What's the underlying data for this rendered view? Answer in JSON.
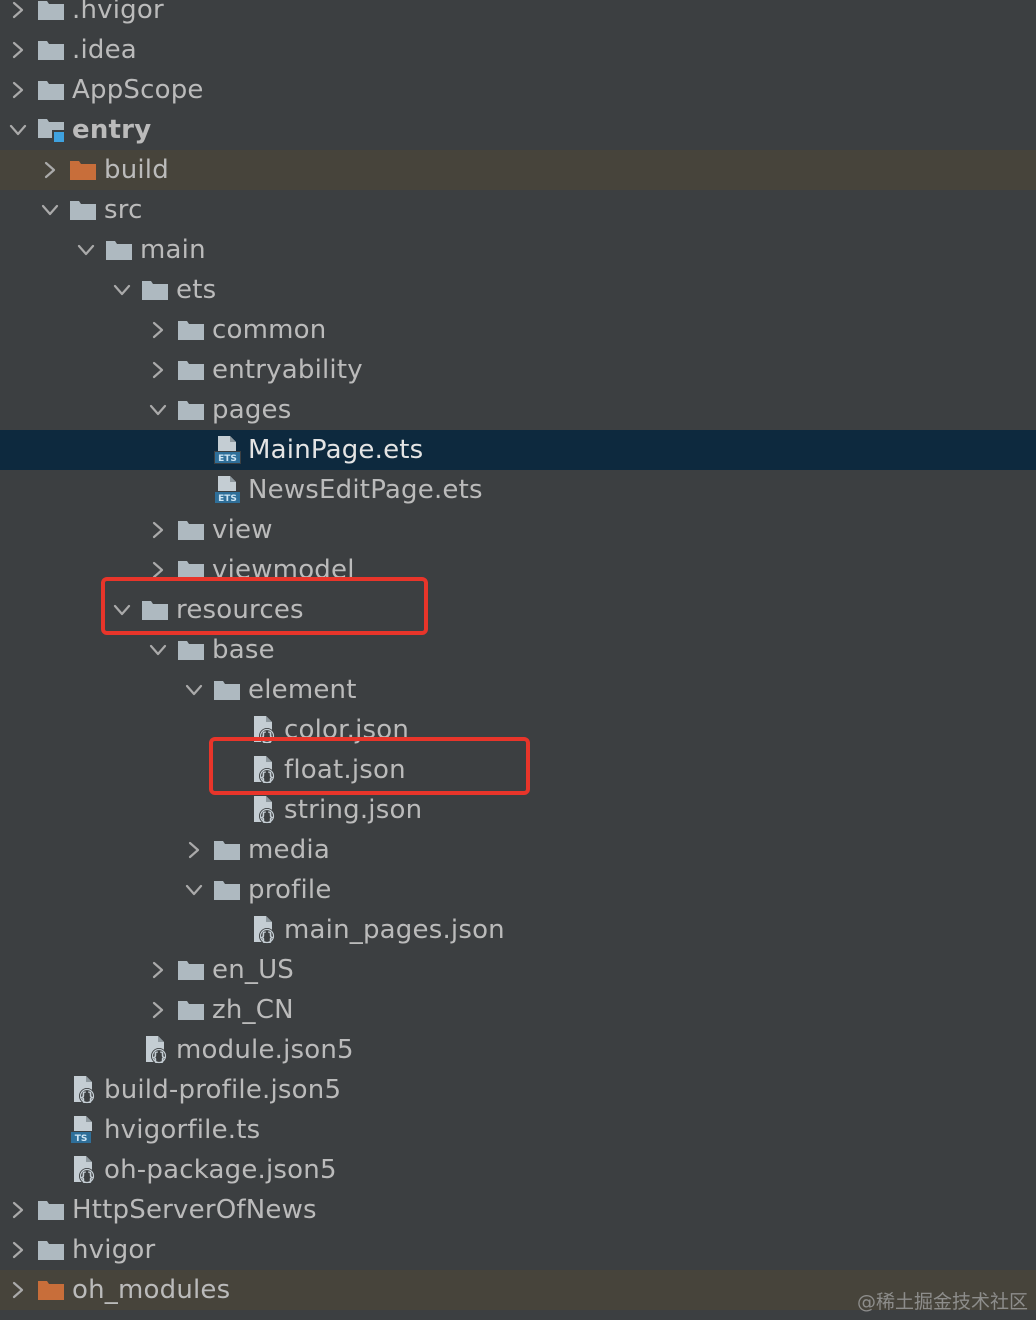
{
  "tree": [
    {
      "label": ".hvigor",
      "depth": 0,
      "type": "folder",
      "expanded": false
    },
    {
      "label": ".idea",
      "depth": 0,
      "type": "folder",
      "expanded": false
    },
    {
      "label": "AppScope",
      "depth": 0,
      "type": "folder",
      "expanded": false
    },
    {
      "label": "entry",
      "depth": 0,
      "type": "module",
      "expanded": true,
      "bold": true
    },
    {
      "label": "build",
      "depth": 1,
      "type": "folder-excluded",
      "expanded": false,
      "state": "excluded"
    },
    {
      "label": "src",
      "depth": 1,
      "type": "folder",
      "expanded": true
    },
    {
      "label": "main",
      "depth": 2,
      "type": "folder",
      "expanded": true
    },
    {
      "label": "ets",
      "depth": 3,
      "type": "folder",
      "expanded": true
    },
    {
      "label": "common",
      "depth": 4,
      "type": "folder",
      "expanded": false
    },
    {
      "label": "entryability",
      "depth": 4,
      "type": "folder",
      "expanded": false
    },
    {
      "label": "pages",
      "depth": 4,
      "type": "folder",
      "expanded": true
    },
    {
      "label": "MainPage.ets",
      "depth": 5,
      "type": "file-ets",
      "state": "selected"
    },
    {
      "label": "NewsEditPage.ets",
      "depth": 5,
      "type": "file-ets"
    },
    {
      "label": "view",
      "depth": 4,
      "type": "folder",
      "expanded": false
    },
    {
      "label": "viewmodel",
      "depth": 4,
      "type": "folder",
      "expanded": false
    },
    {
      "label": "resources",
      "depth": 3,
      "type": "folder",
      "expanded": true,
      "highlight": true
    },
    {
      "label": "base",
      "depth": 4,
      "type": "folder",
      "expanded": true
    },
    {
      "label": "element",
      "depth": 5,
      "type": "folder",
      "expanded": true
    },
    {
      "label": "color.json",
      "depth": 6,
      "type": "file-json"
    },
    {
      "label": "float.json",
      "depth": 6,
      "type": "file-json",
      "highlight": true
    },
    {
      "label": "string.json",
      "depth": 6,
      "type": "file-json"
    },
    {
      "label": "media",
      "depth": 5,
      "type": "folder",
      "expanded": false
    },
    {
      "label": "profile",
      "depth": 5,
      "type": "folder",
      "expanded": true
    },
    {
      "label": "main_pages.json",
      "depth": 6,
      "type": "file-json"
    },
    {
      "label": "en_US",
      "depth": 4,
      "type": "folder",
      "expanded": false
    },
    {
      "label": "zh_CN",
      "depth": 4,
      "type": "folder",
      "expanded": false
    },
    {
      "label": "module.json5",
      "depth": 3,
      "type": "file-json"
    },
    {
      "label": "build-profile.json5",
      "depth": 1,
      "type": "file-json"
    },
    {
      "label": "hvigorfile.ts",
      "depth": 1,
      "type": "file-ts"
    },
    {
      "label": "oh-package.json5",
      "depth": 1,
      "type": "file-json"
    },
    {
      "label": "HttpServerOfNews",
      "depth": 0,
      "type": "folder",
      "expanded": false
    },
    {
      "label": "hvigor",
      "depth": 0,
      "type": "folder",
      "expanded": false
    },
    {
      "label": "oh_modules",
      "depth": 0,
      "type": "folder-excluded",
      "expanded": false,
      "state": "excluded"
    }
  ],
  "colors": {
    "background": "#3c3f41",
    "selected": "#0d293e",
    "excluded": "#47443b",
    "folder": "#aeb9c0",
    "folder_excluded": "#c86e3a",
    "highlight": "#e8352a"
  },
  "watermark": "@稀土掘金技术社区"
}
